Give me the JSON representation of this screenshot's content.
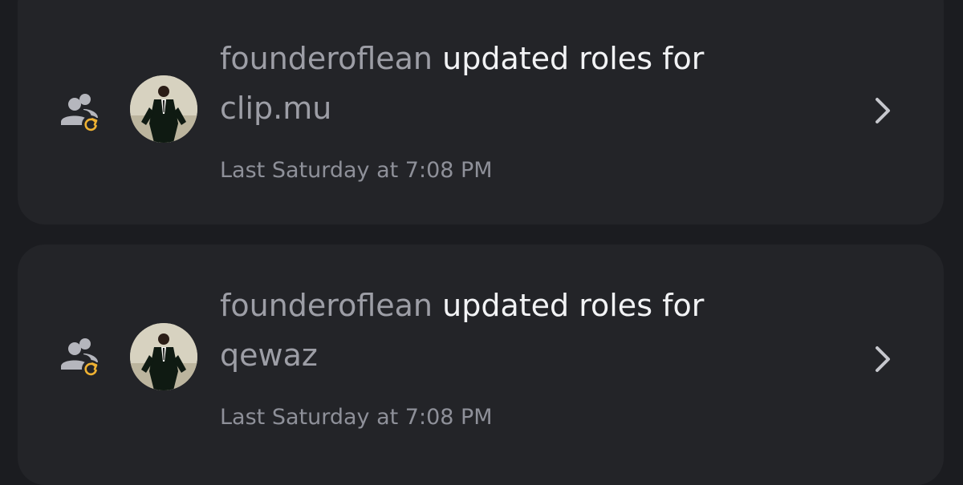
{
  "colors": {
    "background": "#1b1c20",
    "card": "#232428",
    "text_primary": "#f2f3f5",
    "text_muted": "#9d9ea6",
    "badge_orange": "#f0b232"
  },
  "audit_log": {
    "entries": [
      {
        "actor": "founderoflean",
        "action": "updated roles for",
        "target": "clip.mu",
        "timestamp": "Last Saturday at 7:08 PM",
        "icon": "member-role-update-icon"
      },
      {
        "actor": "founderoflean",
        "action": "updated roles for",
        "target": "qewaz",
        "timestamp": "Last Saturday at 7:08 PM",
        "icon": "member-role-update-icon"
      }
    ]
  }
}
